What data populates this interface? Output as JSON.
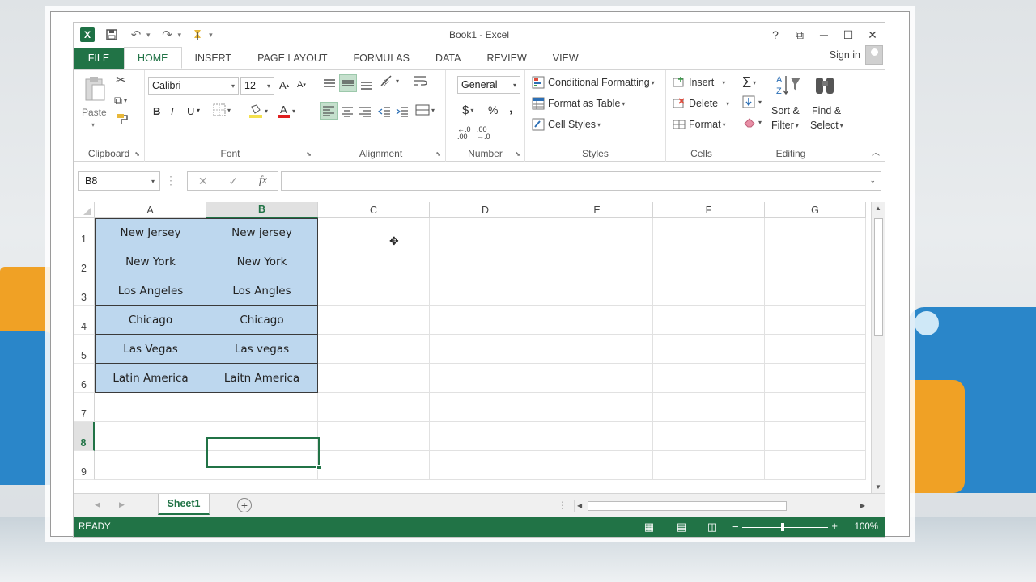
{
  "window": {
    "title": "Book1 - Excel",
    "controls": [
      "?",
      "⧉",
      "─",
      "☐",
      "✕"
    ]
  },
  "quick_access": {
    "app_icon": "X",
    "save": "save-icon",
    "undo": "undo-icon",
    "redo": "redo-icon",
    "touch": "touch-mode-icon"
  },
  "tabs": [
    "FILE",
    "HOME",
    "INSERT",
    "PAGE LAYOUT",
    "FORMULAS",
    "DATA",
    "REVIEW",
    "VIEW"
  ],
  "signin": "Sign in",
  "ribbon": {
    "clipboard": {
      "label": "Clipboard",
      "paste": "Paste"
    },
    "font": {
      "label": "Font",
      "name": "Calibri",
      "size": "12",
      "bold": "B",
      "italic": "I",
      "underline": "U"
    },
    "alignment": {
      "label": "Alignment"
    },
    "number": {
      "label": "Number",
      "format": "General",
      "currency": "$",
      "percent": "%",
      "comma": ","
    },
    "styles": {
      "label": "Styles",
      "conditional": "Conditional Formatting",
      "table": "Format as Table",
      "cell_styles": "Cell Styles"
    },
    "cells": {
      "label": "Cells",
      "insert": "Insert",
      "delete": "Delete",
      "format": "Format"
    },
    "editing": {
      "label": "Editing",
      "sort1": "Sort &",
      "sort2": "Filter",
      "find1": "Find &",
      "find2": "Select"
    }
  },
  "formula_bar": {
    "name_box": "B8",
    "fx": "fx",
    "value": ""
  },
  "columns": [
    "A",
    "B",
    "C",
    "D",
    "E",
    "F",
    "G"
  ],
  "rows": [
    "1",
    "2",
    "3",
    "4",
    "5",
    "6",
    "7",
    "8",
    "9"
  ],
  "cells": {
    "A": [
      "New Jersey",
      "New York",
      "Los Angeles",
      "Chicago",
      "Las Vegas",
      "Latin America"
    ],
    "B": [
      "New jersey",
      "New York",
      "Los Angles",
      "Chicago",
      "Las vegas",
      "Laitn America"
    ]
  },
  "sheet": {
    "tab": "Sheet1",
    "add": "+"
  },
  "status": {
    "mode": "READY",
    "zoom": "100%"
  }
}
